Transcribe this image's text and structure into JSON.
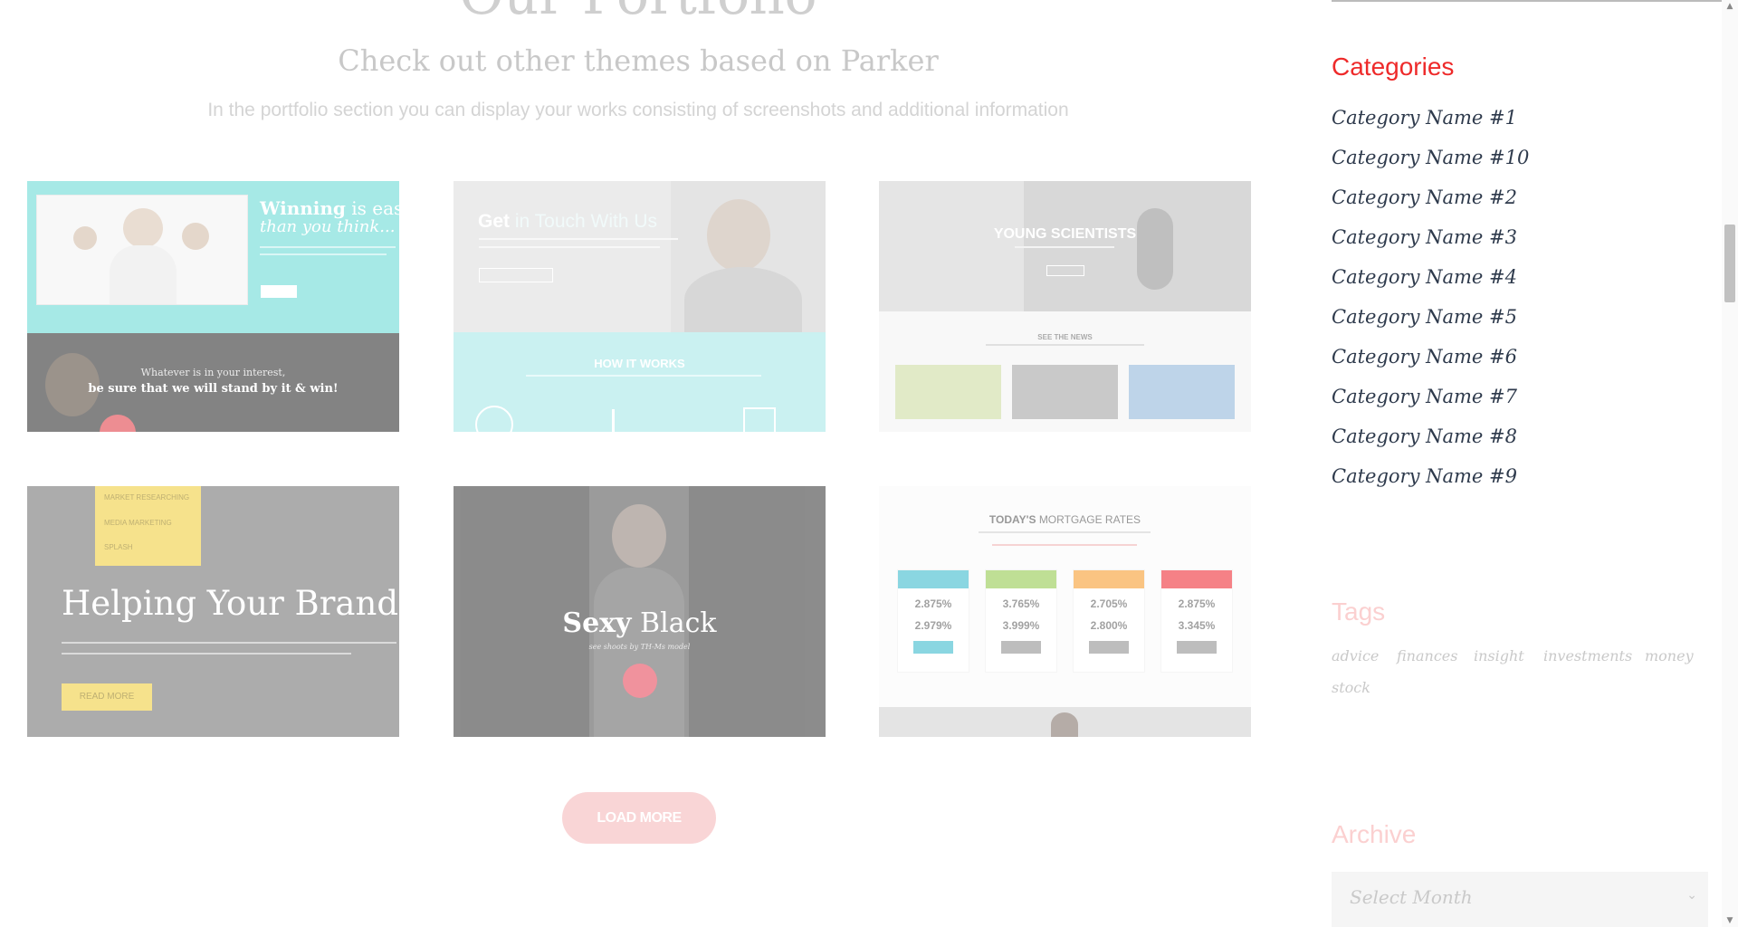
{
  "portfolio": {
    "title": "Our Portfolio",
    "subtitle": "Check out other themes based on Parker",
    "description": "In the portfolio section you can display your works consisting of screenshots and additional information",
    "load_more": "LOAD MORE",
    "items": [
      {
        "heading_bold": "Winning",
        "heading_rest": "is easier",
        "heading_line2": "than you think...",
        "tagline": "Whatever is in your interest,",
        "tagline2": "be sure that we will stand by it & win!"
      },
      {
        "heading_bold": "Get",
        "heading_rest": "in Touch With Us",
        "section": "HOW IT WORKS"
      },
      {
        "title": "YOUNG SCIENTISTS",
        "news_title": "SEE THE NEWS"
      },
      {
        "title": "Helping Your Brand",
        "menu": [
          "MARKET RESEARCHING",
          "MEDIA MARKETING",
          "SPLASH"
        ],
        "button": "READ MORE"
      },
      {
        "title_bold": "Sexy",
        "title_rest": "Black",
        "caption": "see shoots by TH-Ms model"
      },
      {
        "title_bold": "TODAY'S",
        "title_rest": "MORTGAGE RATES",
        "rates": [
          {
            "top": "2.875%",
            "bottom": "2.979%",
            "color": "#2bb5c9"
          },
          {
            "top": "3.765%",
            "bottom": "3.999%",
            "color": "#8cc63f"
          },
          {
            "top": "2.705%",
            "bottom": "2.800%",
            "color": "#f7941d"
          },
          {
            "top": "2.875%",
            "bottom": "3.345%",
            "color": "#ed1c24"
          }
        ]
      }
    ]
  },
  "sidebar": {
    "categories_title": "Categories",
    "categories": [
      "Category Name #1",
      "Category Name #10",
      "Category Name #2",
      "Category Name #3",
      "Category Name #4",
      "Category Name #5",
      "Category Name #6",
      "Category Name #7",
      "Category Name #8",
      "Category Name #9"
    ],
    "tags_title": "Tags",
    "tags": [
      "advice",
      "finances",
      "insight",
      "investments",
      "money",
      "stock"
    ],
    "archive_title": "Archive",
    "archive_select": "Select Month"
  },
  "colors": {
    "accent": "#ee2a2a",
    "accent_faded": "#fbd0d0",
    "link": "#2e3a4c",
    "teal": "#2bc4c4",
    "load_button": "#f9d5d6"
  }
}
